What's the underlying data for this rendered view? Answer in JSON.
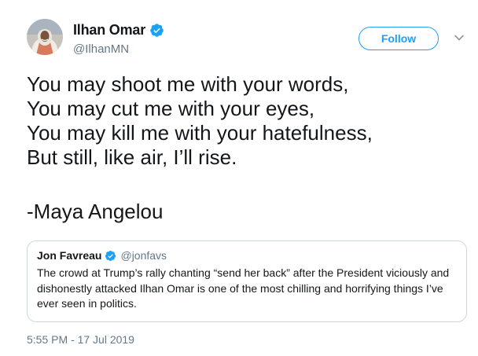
{
  "author": {
    "display_name": "Ilhan Omar",
    "handle": "@IlhanMN",
    "verified": true,
    "avatar_icon": "profile-photo-woman-headscarf"
  },
  "follow_button": {
    "label": "Follow"
  },
  "menu": {
    "icon": "chevron-down-icon"
  },
  "tweet": {
    "lines": [
      "You may shoot me with your words,",
      "You may cut me with your eyes,",
      "You may kill me with your hatefulness,",
      "But still, like air, I’ll rise."
    ],
    "signature": "-Maya Angelou"
  },
  "quoted_tweet": {
    "display_name": "Jon Favreau",
    "handle": "@jonfavs",
    "verified": true,
    "lines": [
      "The crowd at Trump’s rally chanting “send her back” after the President viciously and",
      "dishonestly attacked Ilhan Omar is one of the most chilling and horrifying things I’ve",
      "ever seen in politics."
    ]
  },
  "timestamp": "5:55 PM - 17 Jul 2019",
  "colors": {
    "accent": "#1da1f2",
    "text": "#14171a",
    "secondary": "#657786",
    "border": "#ccd6dd"
  }
}
